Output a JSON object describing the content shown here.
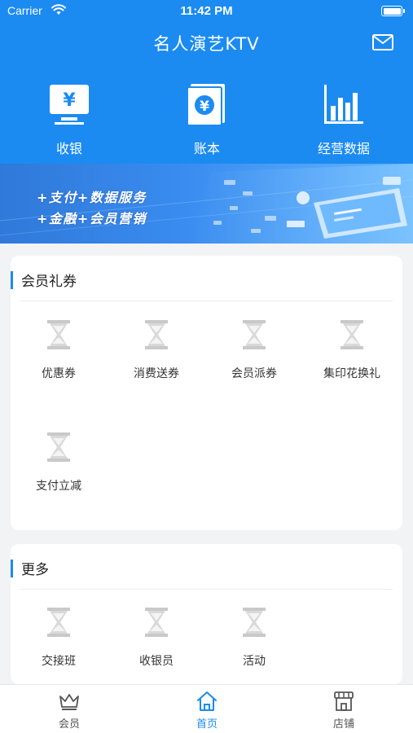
{
  "status_bar": {
    "carrier": "Carrier",
    "time": "11:42 PM"
  },
  "header": {
    "title": "名人演艺KTV",
    "mail_icon": "mail-icon"
  },
  "quick_actions": [
    {
      "label": "收银",
      "icon": "cashier-yen-monitor-icon"
    },
    {
      "label": "账本",
      "icon": "ledger-book-icon"
    },
    {
      "label": "经营数据",
      "icon": "bar-chart-icon"
    }
  ],
  "banner": {
    "line1": "+支付+数据服务",
    "line2": "+金融+会员营销"
  },
  "member_coupons": {
    "title": "会员礼券",
    "items": [
      {
        "label": "优惠券",
        "icon": "hourglass-icon"
      },
      {
        "label": "消费送券",
        "icon": "hourglass-icon"
      },
      {
        "label": "会员派券",
        "icon": "hourglass-icon"
      },
      {
        "label": "集印花换礼",
        "icon": "hourglass-icon"
      },
      {
        "label": "支付立减",
        "icon": "hourglass-icon"
      }
    ]
  },
  "more": {
    "title": "更多",
    "items": [
      {
        "label": "交接班",
        "icon": "hourglass-icon"
      },
      {
        "label": "收银员",
        "icon": "hourglass-icon"
      },
      {
        "label": "活动",
        "icon": "hourglass-icon"
      }
    ]
  },
  "tabbar": {
    "active_color": "#1b8bf1",
    "tabs": [
      {
        "label": "会员",
        "icon": "crown-icon",
        "active": false
      },
      {
        "label": "首页",
        "icon": "home-icon",
        "active": true
      },
      {
        "label": "店铺",
        "icon": "store-icon",
        "active": false
      }
    ]
  },
  "colors": {
    "primary": "#1b8bf1",
    "background": "#f2f3f5"
  }
}
